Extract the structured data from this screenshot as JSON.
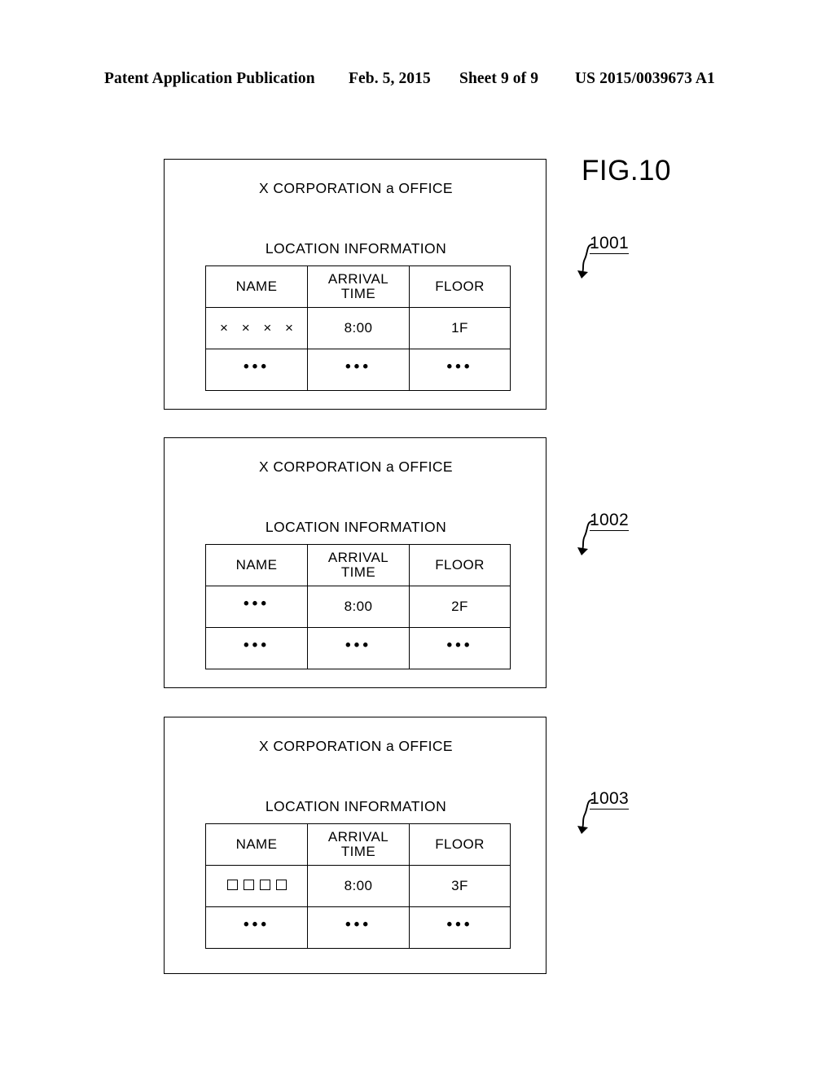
{
  "header": {
    "publication": "Patent Application Publication",
    "date": "Feb. 5, 2015",
    "sheet": "Sheet 9 of 9",
    "patent_number": "US 2015/0039673 A1"
  },
  "figure": {
    "label": "FIG.10"
  },
  "panels": [
    {
      "ref": "1001",
      "title": "X CORPORATION a OFFICE",
      "subtitle": "LOCATION INFORMATION",
      "table": {
        "headers": [
          "NAME",
          "ARRIVAL TIME",
          "FLOOR"
        ],
        "header_time_line1": "ARRIVAL",
        "header_time_line2": "TIME",
        "rows": [
          {
            "name": "× × × ×",
            "name_kind": "xmarks",
            "time": "8:00",
            "floor": "1F"
          },
          {
            "name": "•••",
            "name_kind": "dots",
            "time": "•••",
            "floor": "•••"
          }
        ]
      }
    },
    {
      "ref": "1002",
      "title": "X CORPORATION a OFFICE",
      "subtitle": "LOCATION INFORMATION",
      "table": {
        "headers": [
          "NAME",
          "ARRIVAL TIME",
          "FLOOR"
        ],
        "header_time_line1": "ARRIVAL",
        "header_time_line2": "TIME",
        "rows": [
          {
            "name": "•••",
            "name_kind": "dots",
            "time": "8:00",
            "floor": "2F"
          },
          {
            "name": "•••",
            "name_kind": "dots",
            "time": "•••",
            "floor": "•••"
          }
        ]
      }
    },
    {
      "ref": "1003",
      "title": "X CORPORATION a OFFICE",
      "subtitle": "LOCATION INFORMATION",
      "table": {
        "headers": [
          "NAME",
          "ARRIVAL TIME",
          "FLOOR"
        ],
        "header_time_line1": "ARRIVAL",
        "header_time_line2": "TIME",
        "rows": [
          {
            "name": "□ □ □ □",
            "name_kind": "squares",
            "squares_count": 4,
            "time": "8:00",
            "floor": "3F"
          },
          {
            "name": "•••",
            "name_kind": "dots",
            "time": "•••",
            "floor": "•••"
          }
        ]
      }
    }
  ],
  "colors": {
    "ink": "#000000",
    "paper": "#ffffff"
  }
}
